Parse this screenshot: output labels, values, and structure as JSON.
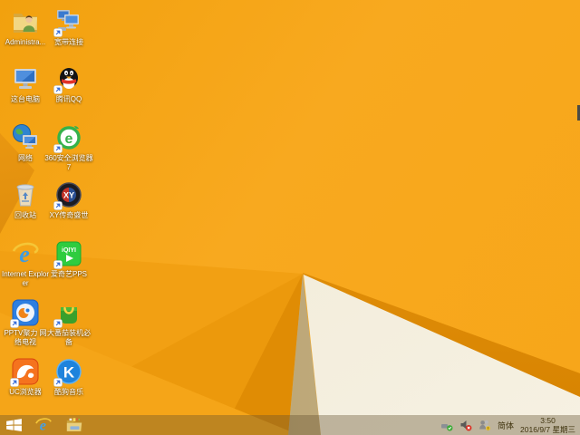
{
  "wallpaper": {
    "base_color": "#F7A71A",
    "fold_shade_1": "#F2A013",
    "fold_shade_2": "#EC990C",
    "fold_shade_3": "#E08C04",
    "lower_left_shade": "#F5A518",
    "left_wedge_top": "#EC9912",
    "left_wedge_bottom": "#CC7D05",
    "tan_wedge": "#BCA575",
    "cream": "#F2ECDB",
    "ridge": "#DC8A02"
  },
  "desktop": {
    "icons": [
      {
        "name": "administrator-folder",
        "label": "Administra...",
        "shortcut": false
      },
      {
        "name": "broadband-connection",
        "label": "宽带连接",
        "shortcut": true
      },
      {
        "name": "this-pc",
        "label": "这台电脑",
        "shortcut": false
      },
      {
        "name": "tencent-qq",
        "label": "腾讯QQ",
        "shortcut": true
      },
      {
        "name": "network",
        "label": "网络",
        "shortcut": false
      },
      {
        "name": "360-safe-browser-7",
        "label": "360安全浏览器7",
        "shortcut": true
      },
      {
        "name": "recycle-bin",
        "label": "回收站",
        "shortcut": false
      },
      {
        "name": "xy-legend-game",
        "label": "XY传奇盛世",
        "shortcut": true
      },
      {
        "name": "internet-explorer",
        "label": "Internet Explorer",
        "shortcut": false
      },
      {
        "name": "iqiyi-pps",
        "label": "爱奇艺PPS",
        "shortcut": true
      },
      {
        "name": "pptv-tv",
        "label": "PPTV聚力 网络电视",
        "shortcut": true
      },
      {
        "name": "big-tomato",
        "label": "大番茄装机必备",
        "shortcut": true
      },
      {
        "name": "uc-browser",
        "label": "UC浏览器",
        "shortcut": true
      },
      {
        "name": "kugou-music",
        "label": "酷狗音乐",
        "shortcut": true
      }
    ]
  },
  "taskbar": {
    "tray": {
      "input_indicator": "简体",
      "time": "3:50",
      "date": "2016/9/7 星期三"
    }
  }
}
